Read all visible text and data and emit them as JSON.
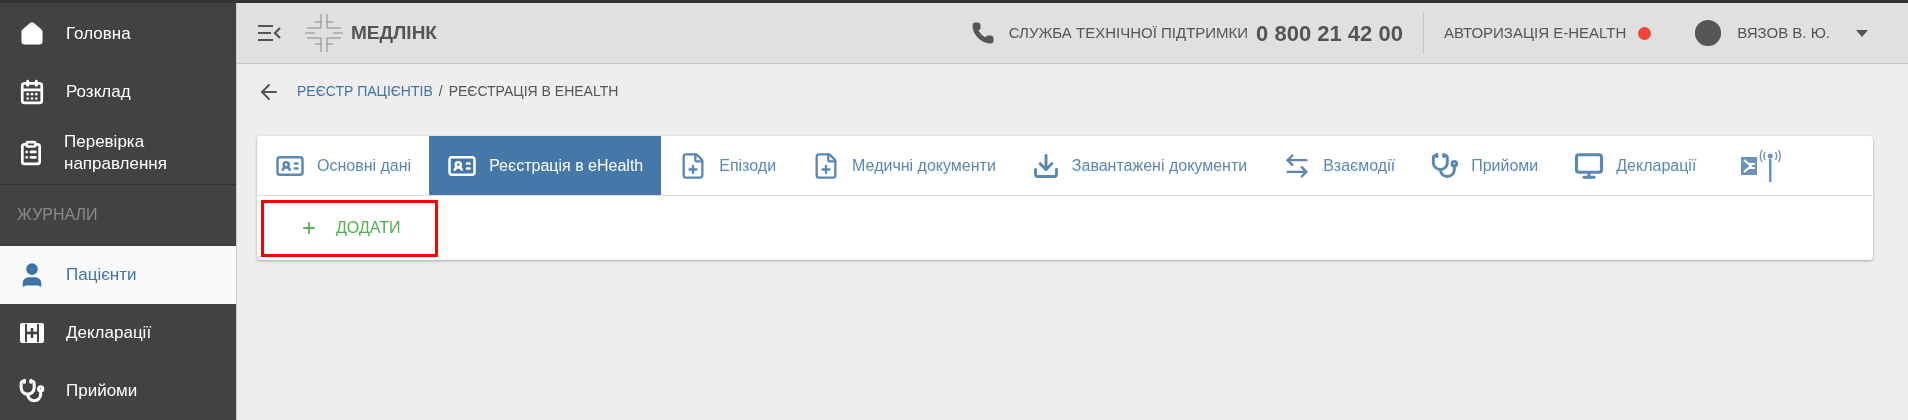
{
  "sidebar": {
    "items": [
      {
        "label": "Головна",
        "selected": false
      },
      {
        "label": "Розклад",
        "selected": false
      },
      {
        "label": "Перевірка направлення",
        "selected": false
      }
    ],
    "section_title": "ЖУРНАЛИ",
    "journal_items": [
      {
        "label": "Пацієнти",
        "selected": true
      },
      {
        "label": "Декларації",
        "selected": false
      },
      {
        "label": "Прийоми",
        "selected": false
      }
    ]
  },
  "header": {
    "logo_text": "МЕДЛІНК",
    "support_label": "СЛУЖБА ТЕХНІЧНОЇ ПІДТРИМКИ",
    "support_phone": "0 800 21 42 00",
    "auth_label": "АВТОРИЗАЦІЯ E-HEALTH",
    "user_name": "ВЯЗОВ В. Ю."
  },
  "breadcrumb": [
    {
      "label": "РЕЄСТР ПАЦІЄНТІВ",
      "kind": "link"
    },
    {
      "label": "/",
      "kind": "separator"
    },
    {
      "label": "РЕЄСТРАЦІЯ В EHEALTH",
      "kind": "current"
    }
  ],
  "tabs": [
    {
      "label": "Основні дані",
      "selected": false
    },
    {
      "label": "Реєстрація в eHealth",
      "selected": true
    },
    {
      "label": "Епізоди",
      "selected": false
    },
    {
      "label": "Медичні документи",
      "selected": false
    },
    {
      "label": "Завантажені документи",
      "selected": false
    },
    {
      "label": "Взаємодії",
      "selected": false
    },
    {
      "label": "Прийоми",
      "selected": false
    },
    {
      "label": "Декларації",
      "selected": false
    },
    {
      "selected": false
    }
  ],
  "add_button": {
    "icon": "+",
    "label": "ДОДАТИ"
  }
}
